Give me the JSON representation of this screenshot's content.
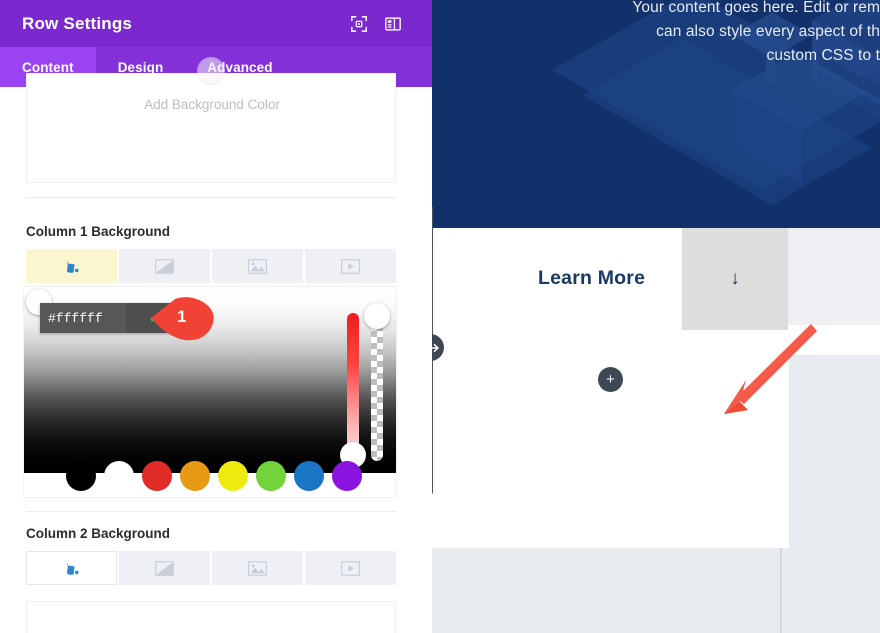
{
  "panel": {
    "title": "Row Settings",
    "header_icons": [
      {
        "name": "focus-frame-icon",
        "label": "Expand"
      },
      {
        "name": "layout-columns-icon",
        "label": "Layout"
      }
    ],
    "tabs": [
      {
        "label": "Content",
        "active": true
      },
      {
        "label": "Design",
        "active": false
      },
      {
        "label": "Advanced",
        "active": false
      }
    ],
    "background_preview": {
      "placeholder": "Add Background Color"
    },
    "sections": [
      {
        "label": "Column 1 Background",
        "toggles": [
          {
            "name": "bucket-icon",
            "active": true
          },
          {
            "name": "gradient-icon",
            "active": false
          },
          {
            "name": "image-icon",
            "active": false
          },
          {
            "name": "video-icon",
            "active": false
          }
        ]
      },
      {
        "label": "Column 2 Background",
        "toggles": [
          {
            "name": "bucket-icon",
            "active": true
          },
          {
            "name": "gradient-icon",
            "active": false
          },
          {
            "name": "image-icon",
            "active": false
          },
          {
            "name": "video-icon",
            "active": false
          }
        ]
      }
    ],
    "color_picker": {
      "hex_value": "#ffffff",
      "confirm_label": "✓",
      "hue_label": "Hue",
      "alpha_label": "Alpha",
      "swatches": [
        {
          "name": "swatch-black",
          "hex": "#000000"
        },
        {
          "name": "swatch-white",
          "hex": "#ffffff"
        },
        {
          "name": "swatch-red",
          "hex": "#e02b27"
        },
        {
          "name": "swatch-orange",
          "hex": "#e89a17"
        },
        {
          "name": "swatch-yellow",
          "hex": "#edea10"
        },
        {
          "name": "swatch-green",
          "hex": "#72d33a"
        },
        {
          "name": "swatch-blue",
          "hex": "#1a75c6"
        },
        {
          "name": "swatch-purple",
          "hex": "#8a13e0"
        }
      ]
    }
  },
  "annotation": {
    "marker_number": "1",
    "marker_color": "#f04335",
    "arrow_color": "#f45b4a"
  },
  "preview": {
    "hero_text_lines": [
      "Your content goes here. Edit or rem",
      "can also style every aspect of th",
      "custom CSS to t"
    ],
    "learn_more_label": "Learn More",
    "scroll_down_icon": "↓",
    "add_module_label": "+",
    "resize_handle_icon": "↔"
  },
  "colors": {
    "header_purple": "#7b29cf",
    "tab_purple": "#8431da",
    "tab_active_purple": "#9a43f0",
    "hero_navy": "#12306a",
    "accent_yellow": "#fcf6cf"
  }
}
